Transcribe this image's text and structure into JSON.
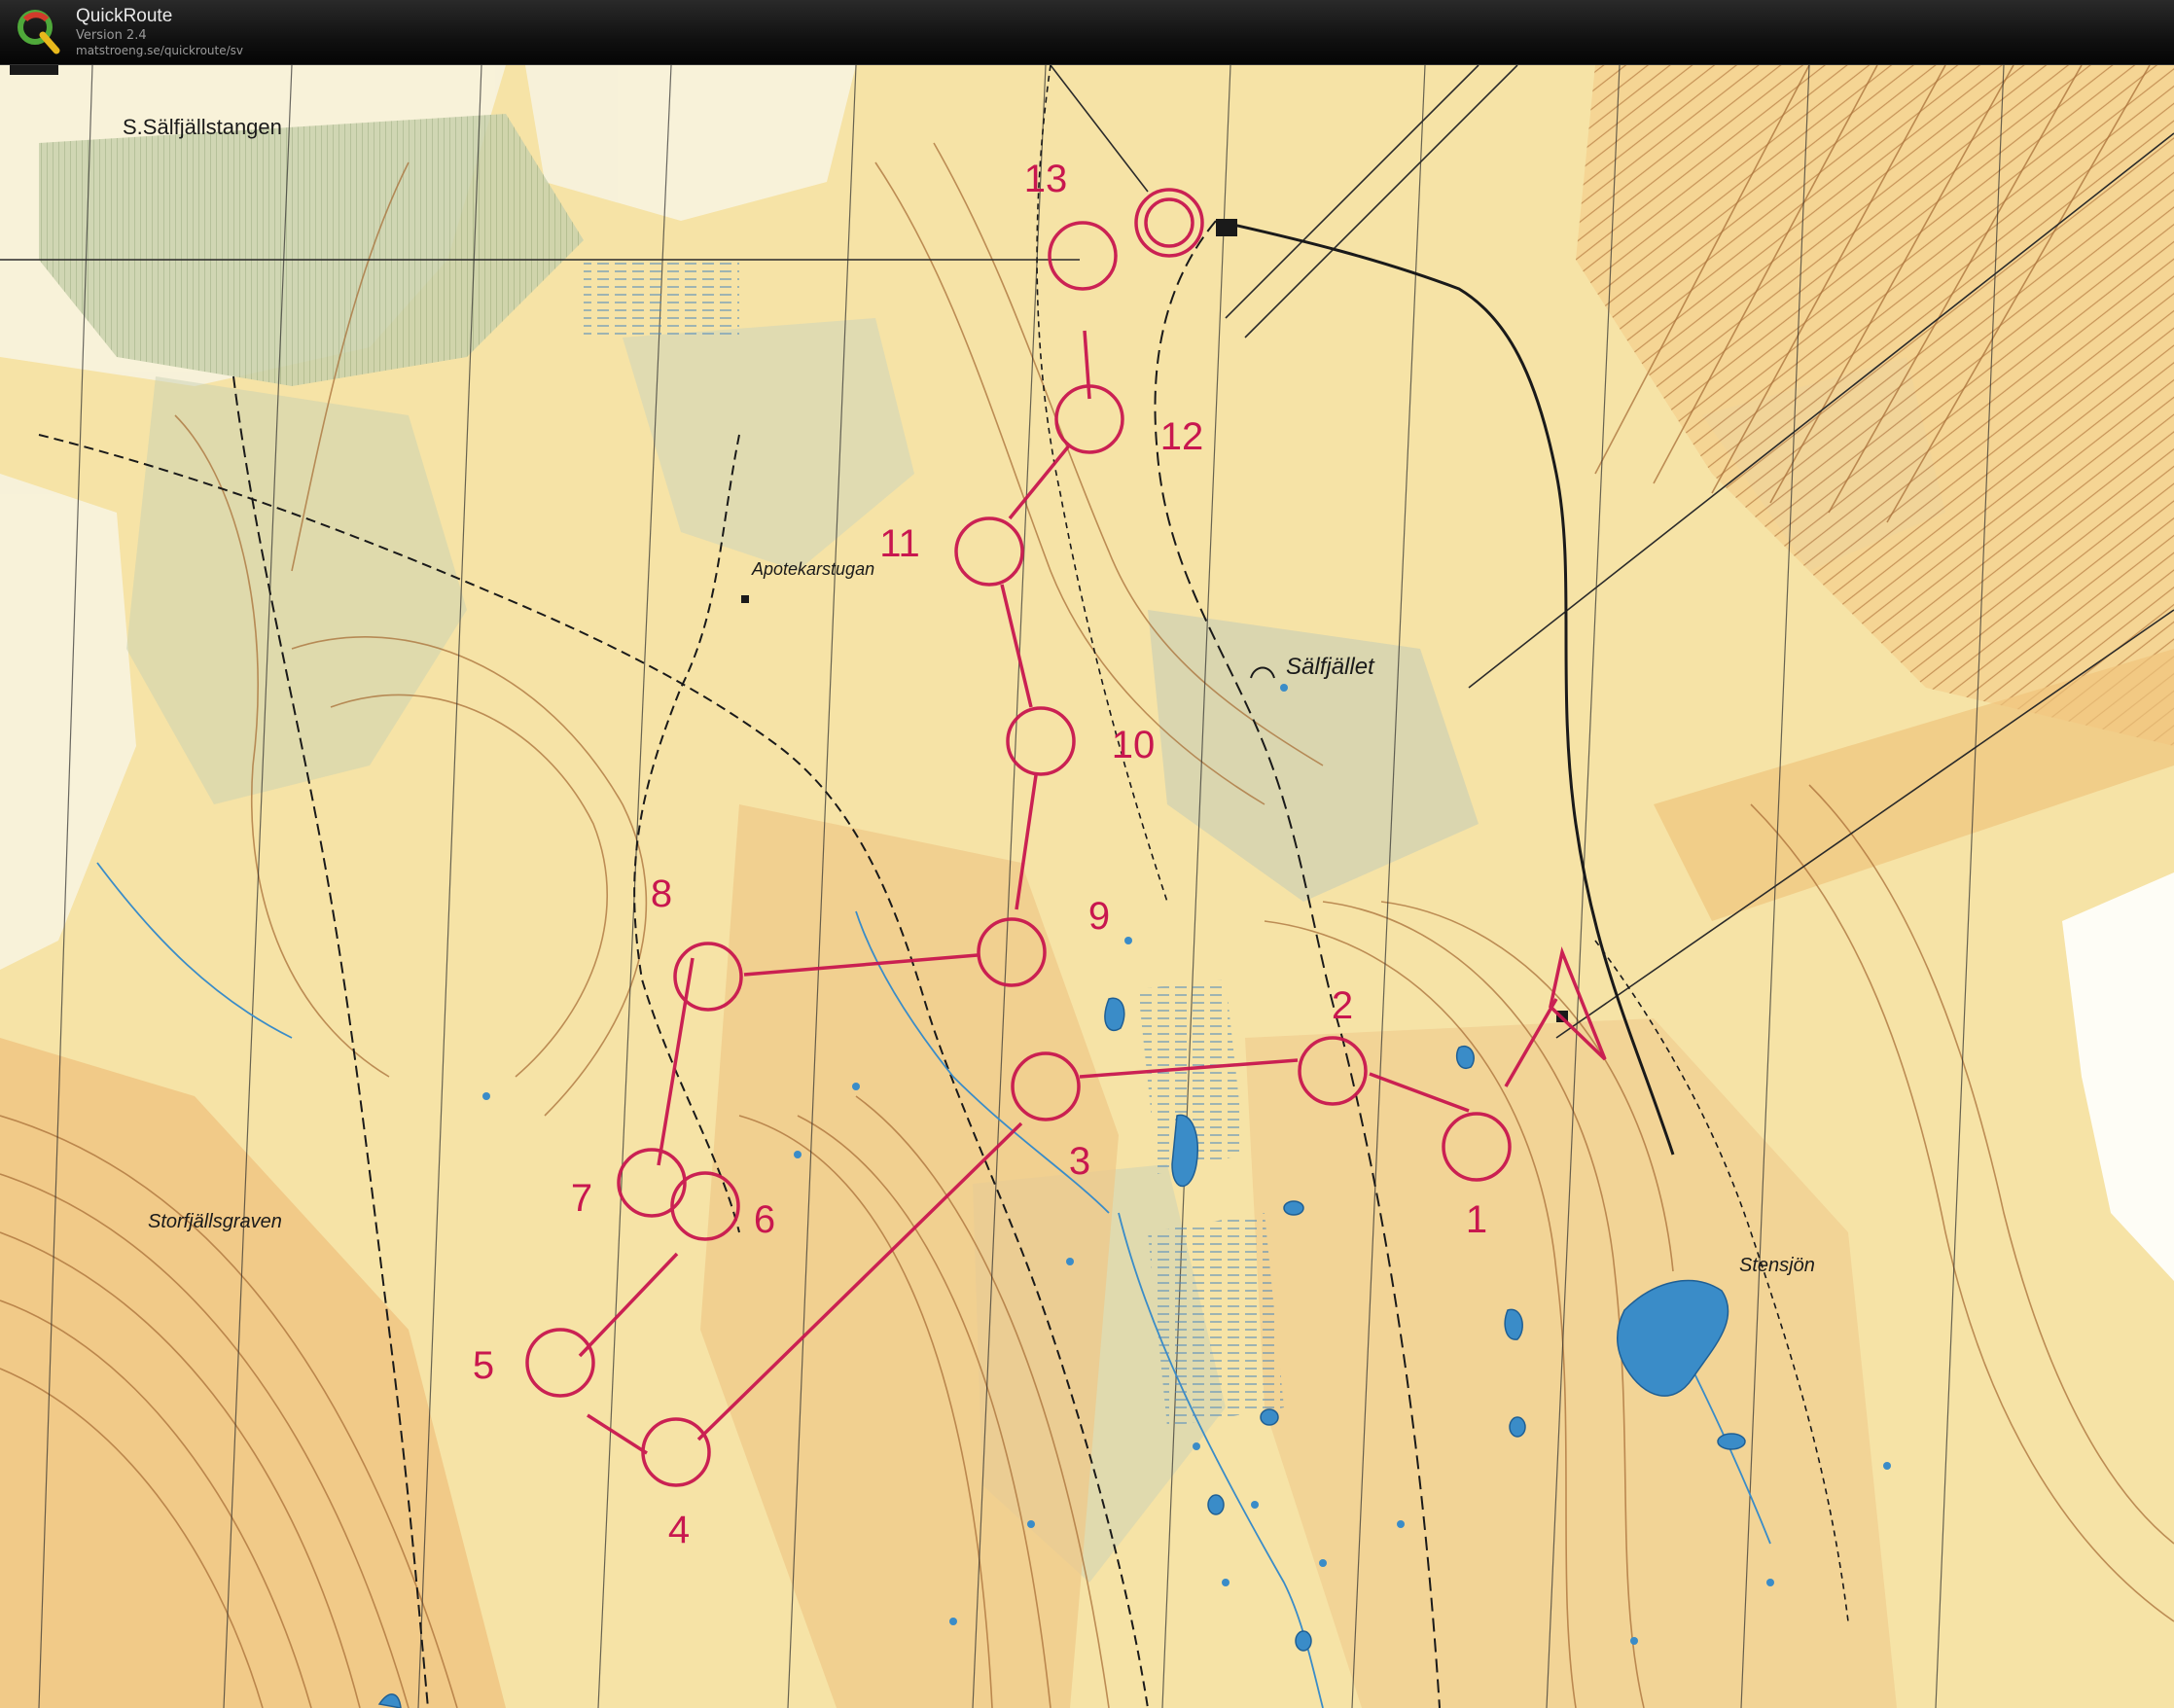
{
  "app": {
    "title": "QuickRoute",
    "version": "Version 2.4",
    "url": "matstroeng.se/quickroute/sv"
  },
  "map": {
    "place_names": [
      {
        "id": "s-salfjallstangen",
        "text": "S.Sälfjällstangen"
      },
      {
        "id": "apotekarstugan",
        "text": "Apotekarstugan"
      },
      {
        "id": "salfjallet",
        "text": "Sälfjället"
      },
      {
        "id": "storfjallsgraven",
        "text": "Storfjällsgraven"
      },
      {
        "id": "stensjon",
        "text": "Stensjön"
      }
    ],
    "course": {
      "color": "#c8174f",
      "start": "start",
      "controls": [
        "1",
        "2",
        "3",
        "4",
        "5",
        "6",
        "7",
        "8",
        "9",
        "10",
        "11",
        "12",
        "13"
      ],
      "finish": "finish"
    },
    "colors": {
      "open_land": "#f5e4a5",
      "rough_open": "#efc983",
      "forest": "#f7f2dc",
      "green": "#bcc79f",
      "water": "#3a8cc8",
      "contour": "#a06a35",
      "course": "#c8174f"
    }
  }
}
